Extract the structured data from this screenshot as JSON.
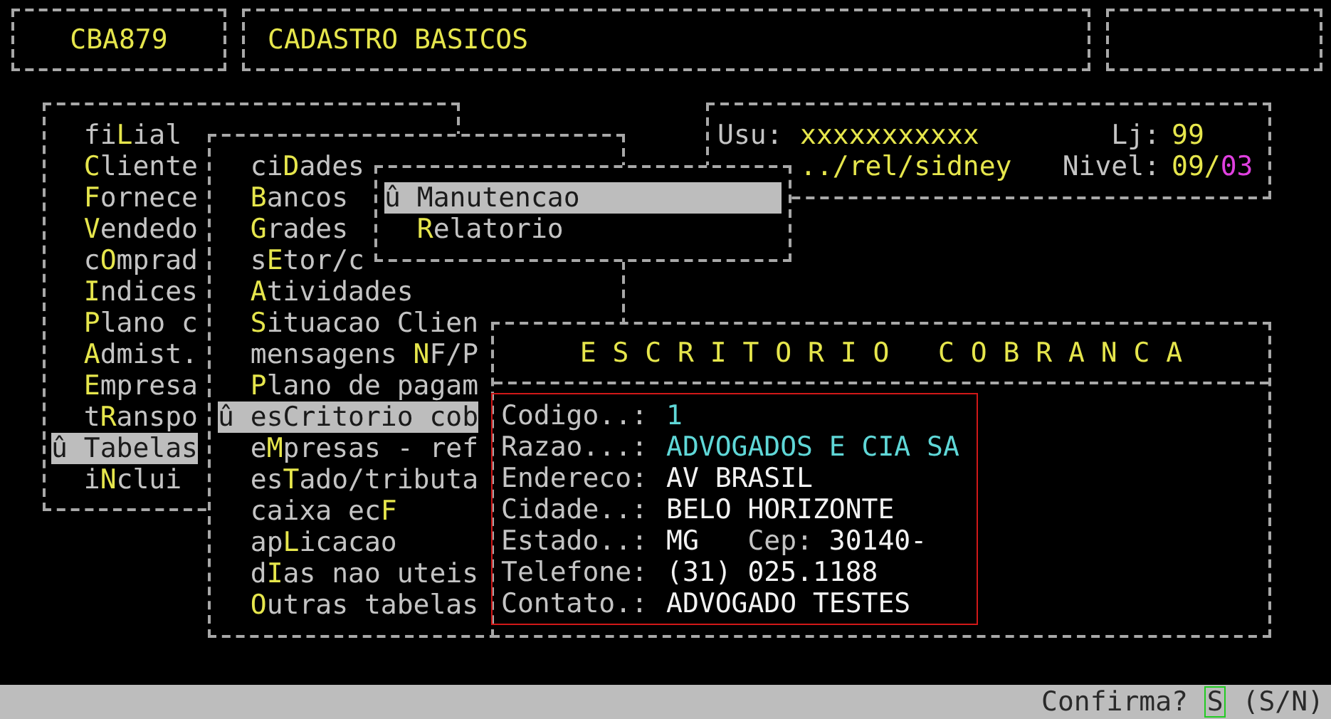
{
  "header": {
    "program_code": "CBA879",
    "title": "CADASTRO BASICOS"
  },
  "main_menu": {
    "items": [
      {
        "before": "fi",
        "key": "L",
        "after": "ial",
        "selected": false
      },
      {
        "key": "C",
        "after": "liente",
        "selected": false
      },
      {
        "key": "F",
        "after": "ornece",
        "selected": false
      },
      {
        "key": "V",
        "after": "endedo",
        "selected": false
      },
      {
        "before": "c",
        "key": "O",
        "after": "mprad",
        "selected": false
      },
      {
        "key": "I",
        "after": "ndices",
        "selected": false
      },
      {
        "key": "P",
        "after": "lano c",
        "selected": false
      },
      {
        "key": "A",
        "after": "dmist.",
        "selected": false
      },
      {
        "key": "E",
        "after": "mpresa",
        "selected": false
      },
      {
        "before": "t",
        "key": "R",
        "after": "anspo",
        "selected": false
      },
      {
        "marker": "û",
        "key": "T",
        "after": "abelas",
        "selected": true
      },
      {
        "before": "i",
        "key": "N",
        "after": "clui",
        "selected": false
      }
    ]
  },
  "user_info": {
    "user_label": "Usu:",
    "user": "xxxxxxxxxxx",
    "store_label": "Lj:",
    "store": "99",
    "path": "../rel/sidney",
    "level_label": "Nivel:",
    "level_parts": [
      {
        "text": "09/",
        "color": "#e6e64c"
      },
      {
        "text": "03",
        "color": "#e040e0"
      }
    ]
  },
  "tables_menu": {
    "items": [
      {
        "before": "ci",
        "key": "D",
        "after": "ades",
        "selected": false
      },
      {
        "key": "B",
        "after": "ancos",
        "selected": false
      },
      {
        "key": "G",
        "after": "rades",
        "selected": false
      },
      {
        "before": "s",
        "key": "E",
        "after": "tor/c",
        "selected": false
      },
      {
        "key": "A",
        "after": "tividades",
        "selected": false
      },
      {
        "key": "S",
        "after": "ituacao Clien",
        "selected": false
      },
      {
        "before": "mensagens ",
        "key": "N",
        "after": "F/P",
        "selected": false
      },
      {
        "key": "P",
        "after": "lano de pagam",
        "selected": false
      },
      {
        "marker": "û",
        "before": "es",
        "key": "C",
        "after": "ritorio cob",
        "selected": true
      },
      {
        "before": "e",
        "key": "M",
        "after": "presas - ref",
        "selected": false
      },
      {
        "before": "es",
        "key": "T",
        "after": "ado/tributa",
        "selected": false
      },
      {
        "before": "caixa ec",
        "key": "F",
        "selected": false
      },
      {
        "before": "ap",
        "key": "L",
        "after": "icacao",
        "selected": false
      },
      {
        "before": "d",
        "key": "I",
        "after": "as nao uteis",
        "selected": false
      },
      {
        "key": "O",
        "after": "utras tabelas",
        "selected": false
      }
    ]
  },
  "action_menu": {
    "items": [
      {
        "marker": "û",
        "key": "M",
        "after": "anutencao",
        "selected": true
      },
      {
        "key": "R",
        "after": "elatorio",
        "selected": false
      }
    ]
  },
  "record": {
    "title": "E S C R I T O R I O   C O B R A N C A",
    "fields": [
      {
        "label": "Codigo..:",
        "value": "1",
        "color": "#5fd7d7"
      },
      {
        "label": "Razao...:",
        "value": "ADVOGADOS E CIA SA",
        "color": "#5fd7d7"
      },
      {
        "label": "Endereco:",
        "value": "AV BRASIL",
        "color": "#f2f2f2"
      },
      {
        "label": "Cidade..:",
        "value": "BELO HORIZONTE",
        "color": "#f2f2f2"
      },
      {
        "label": "Estado..:",
        "value": "MG",
        "color": "#f2f2f2",
        "extra_label": "Cep:",
        "extra_value": "30140-"
      },
      {
        "label": "Telefone:",
        "value": "(31) 025.1188",
        "color": "#f2f2f2"
      },
      {
        "label": "Contato.:",
        "value": "ADVOGADO TESTES",
        "color": "#f2f2f2"
      }
    ]
  },
  "status_bar": {
    "prompt": "Confirma?",
    "answer": "S",
    "options": "(S/N)"
  }
}
